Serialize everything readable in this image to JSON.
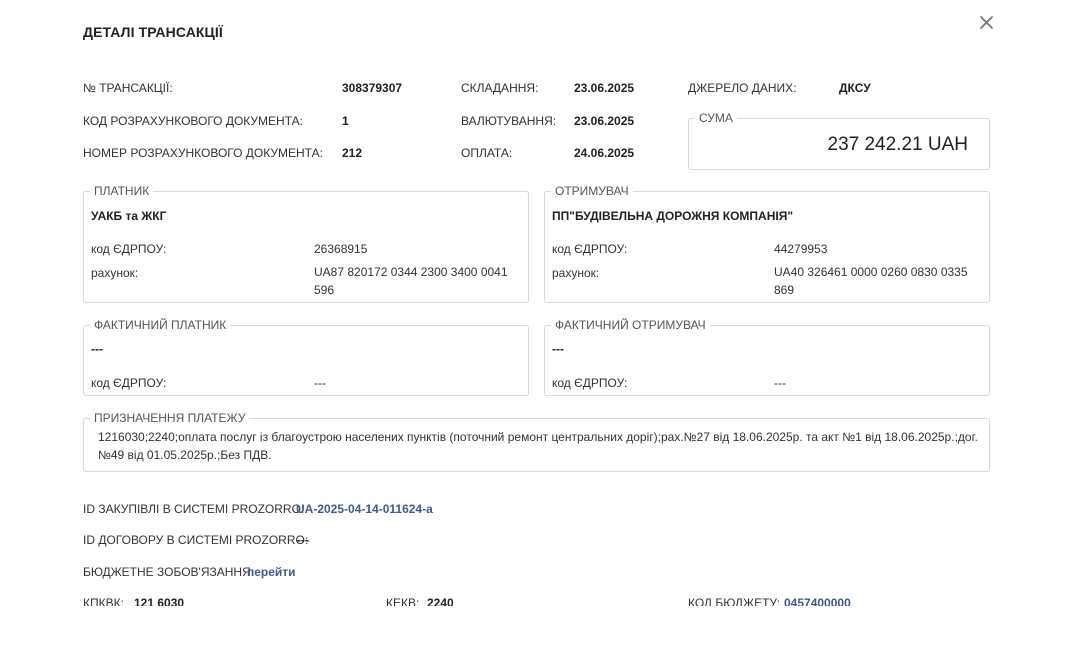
{
  "header": {
    "title": "ДЕТАЛІ ТРАНСАКЦІЇ"
  },
  "info": {
    "trans_no_label": "№ ТРАНСАКЦІЇ:",
    "trans_no_value": "308379307",
    "doc_code_label": "КОД РОЗРАХУНКОВОГО ДОКУМЕНТА:",
    "doc_code_value": "1",
    "doc_no_label": "НОМЕР РОЗРАХУНКОВОГО ДОКУМЕНТА:",
    "doc_no_value": "212",
    "created_label": "СКЛАДАННЯ:",
    "created_value": "23.06.2025",
    "value_date_label": "ВАЛЮТУВАННЯ:",
    "value_date_value": "23.06.2025",
    "paid_label": "ОПЛАТА:",
    "paid_value": "24.06.2025",
    "source_label": "ДЖЕРЕЛО ДАНИХ:",
    "source_value": "ДКСУ"
  },
  "sum": {
    "legend": "СУМА",
    "value": "237 242.21 UAH"
  },
  "payer": {
    "legend": "ПЛАТНИК",
    "name": "УАКБ та ЖКГ",
    "edrpou_label": "код ЄДРПОУ:",
    "edrpou_value": "26368915",
    "account_label": "рахунок:",
    "account_line1": "UA87 820172 0344 2300 3400 0041",
    "account_line2": "596"
  },
  "receiver": {
    "legend": "ОТРИМУВАЧ",
    "name": "ПП\"БУДІВЕЛЬНА ДОРОЖНЯ КОМПАНІЯ\"",
    "edrpou_label": "код ЄДРПОУ:",
    "edrpou_value": "44279953",
    "account_label": "рахунок:",
    "account_line1": "UA40 326461 0000 0260 0830 0335",
    "account_line2": "869"
  },
  "actual_payer": {
    "legend": "ФАКТИЧНИЙ ПЛАТНИК",
    "name": "---",
    "edrpou_label": "код ЄДРПОУ:",
    "edrpou_value": "---"
  },
  "actual_receiver": {
    "legend": "ФАКТИЧНИЙ ОТРИМУВАЧ",
    "name": "---",
    "edrpou_label": "код ЄДРПОУ:",
    "edrpou_value": "---"
  },
  "purpose": {
    "legend": "ПРИЗНАЧЕННЯ ПЛАТЕЖУ",
    "line1": "1216030;2240;оплата послуг із благоустрою населених пунктів (поточний ремонт центральних доріг);рах.№27 від 18.06.2025р. та акт №1 від 18.06.2025р.;дог.",
    "line2": "№49 від 01.05.2025р.;Без ПДВ."
  },
  "footer": {
    "prozorro_id_label": "ID ЗАКУПІВЛІ В СИСТЕМІ PROZORRO:",
    "prozorro_id_value": "UA-2025-04-14-011624-a",
    "contract_id_label": "ID ДОГОВОРУ В СИСТЕМІ PROZORRO:",
    "contract_id_value": "---",
    "budget_label": "БЮДЖЕТНЕ ЗОБОВ'ЯЗАННЯ:",
    "budget_link": "перейти",
    "kpkvk_label": "КПКВК:",
    "kpkvk_value": "121 6030",
    "kekv_label": "КЕКВ:",
    "kekv_value": "2240",
    "budget_code_label": "КОД БЮДЖЕТУ:",
    "budget_code_value": "0457400000"
  },
  "icons": {
    "close": "close-icon"
  },
  "colors": {
    "link": "#3d5a8a",
    "border": "#d6d9de"
  }
}
